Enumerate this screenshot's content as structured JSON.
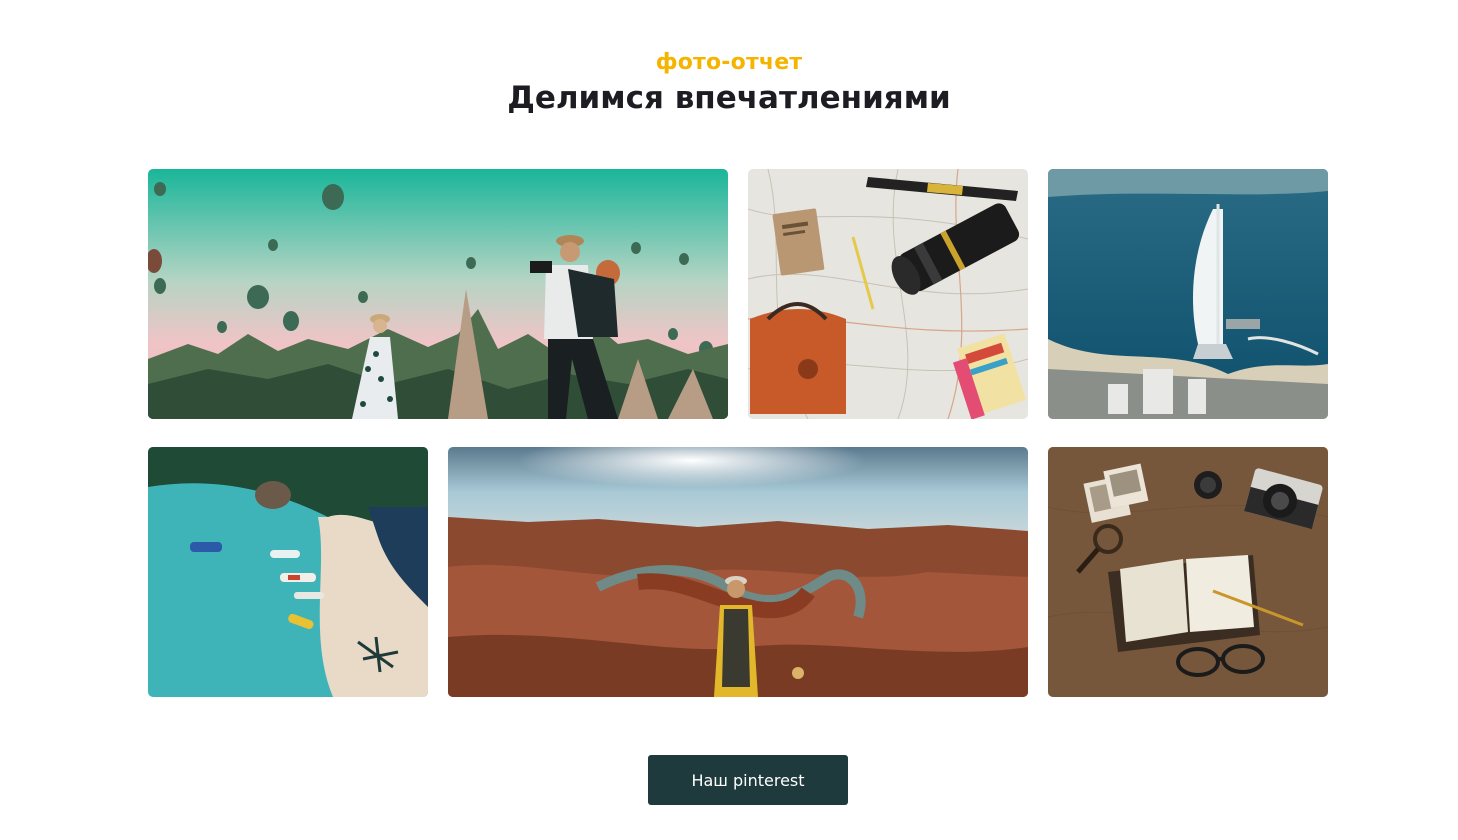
{
  "section": {
    "eyebrow": "фото-отчет",
    "title": "Делимся впечатлениями"
  },
  "gallery": {
    "photos": [
      {
        "subject": "hot air balloons over valley with traveler couple"
      },
      {
        "subject": "flat-lay map with camera, notebook and backpack"
      },
      {
        "subject": "aerial view of sail-shaped hotel on the coast"
      },
      {
        "subject": "aerial beach with boats in turquoise water"
      },
      {
        "subject": "hiker overlooking river canyon bend"
      },
      {
        "subject": "vintage camera, notebook and glasses on old map"
      }
    ]
  },
  "cta": {
    "label": "Наш pinterest"
  },
  "colors": {
    "accent": "#f4b400",
    "button_bg": "#1e3a3c",
    "heading": "#1c1c22"
  }
}
